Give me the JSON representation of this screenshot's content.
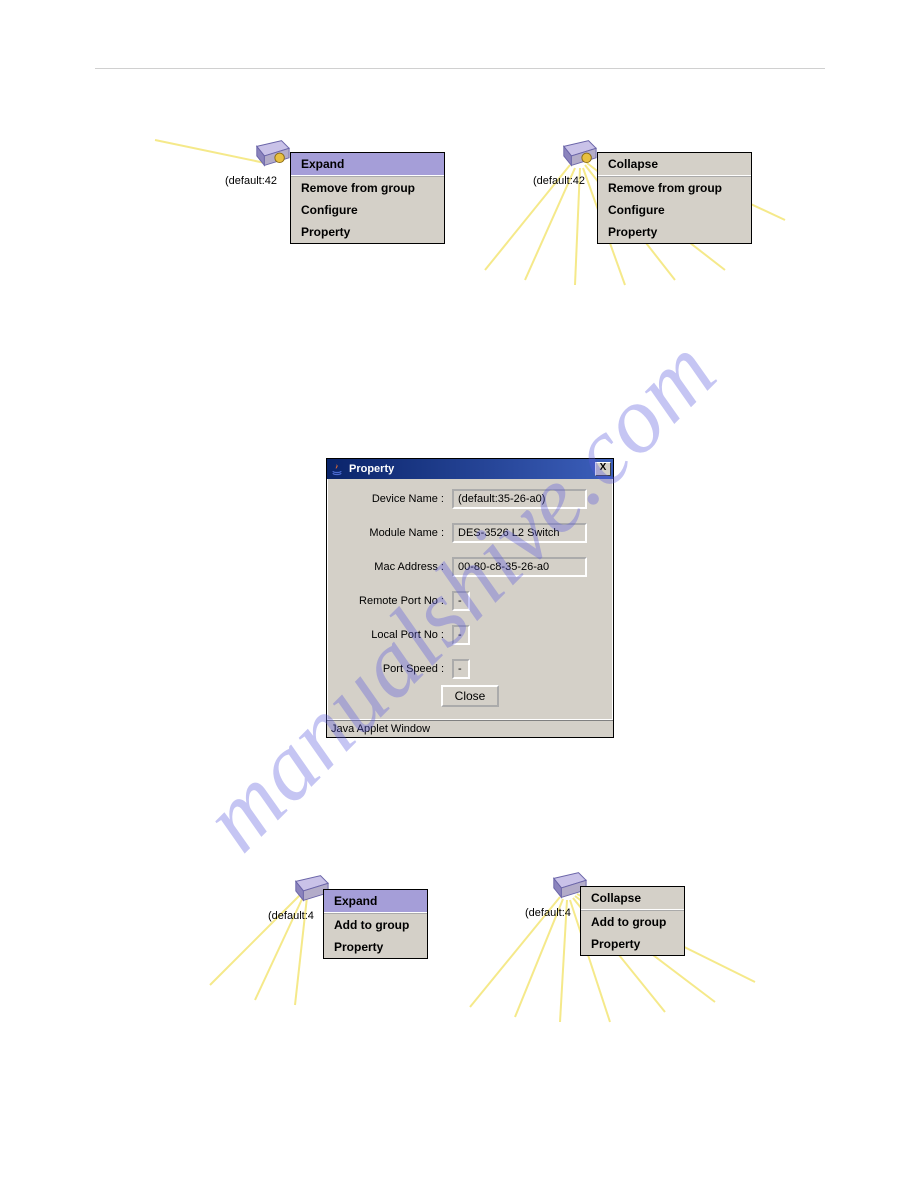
{
  "watermark": "manualshive.com",
  "menus": {
    "top_left": {
      "device_label": "(default:42",
      "items": [
        "Expand",
        "Remove from group",
        "Configure",
        "Property"
      ],
      "highlight_index": 0
    },
    "top_right": {
      "device_label": "(default:42",
      "items": [
        "Collapse",
        "Remove from group",
        "Configure",
        "Property"
      ],
      "highlight_index": -1
    },
    "bottom_left": {
      "device_label": "(default:4",
      "items": [
        "Expand",
        "Add to group",
        "Property"
      ],
      "highlight_index": 0
    },
    "bottom_right": {
      "device_label": "(default:4",
      "items": [
        "Collapse",
        "Add to group",
        "Property"
      ],
      "highlight_index": -1
    }
  },
  "dialog": {
    "title": "Property",
    "close_glyph": "X",
    "fields": {
      "device_name": {
        "label": "Device Name :",
        "value": "(default:35-26-a0)"
      },
      "module_name": {
        "label": "Module Name :",
        "value": "DES-3526 L2 Switch"
      },
      "mac_address": {
        "label": "Mac Address :",
        "value": "00-80-c8-35-26-a0"
      },
      "remote_port": {
        "label": "Remote Port No :",
        "value": "-"
      },
      "local_port": {
        "label": "Local Port No :",
        "value": "-"
      },
      "port_speed": {
        "label": "Port Speed :",
        "value": "-"
      }
    },
    "close_button": "Close",
    "status": "Java Applet Window"
  }
}
